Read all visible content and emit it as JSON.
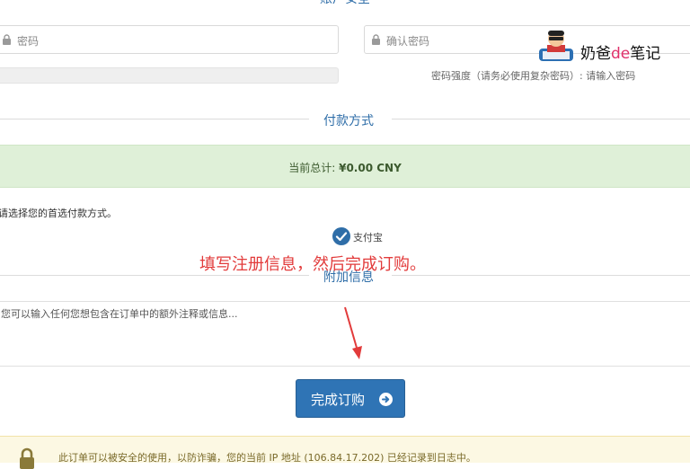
{
  "account_section": {
    "title": "账户安全"
  },
  "password": {
    "placeholder": "密码"
  },
  "confirm_password": {
    "placeholder": "确认密码"
  },
  "strength": {
    "text": "密码强度（请务必使用复杂密码）: 请输入密码"
  },
  "watermark": {
    "text_pre": "奶爸",
    "text_de": "de",
    "text_post": "笔记"
  },
  "payment_section": {
    "title": "付款方式"
  },
  "total": {
    "label": "当前总计:",
    "amount": "¥0.00 CNY"
  },
  "payment": {
    "choose_text": "请选择您的首选付款方式。",
    "option_label": "支付宝"
  },
  "annotation": {
    "text": "填写注册信息，然后完成订购。"
  },
  "notes_section": {
    "title": "附加信息"
  },
  "notes": {
    "placeholder": "您可以输入任何您想包含在订单中的额外注释或信息..."
  },
  "submit": {
    "label": "完成订购"
  },
  "security_notice": {
    "text": "此订单可以被安全的使用，以防诈骗，您的当前 IP 地址 (106.84.17.202) 已经记录到日志中。"
  },
  "colors": {
    "accent": "#2f74b5",
    "success_bg": "#dff0d8",
    "annotation": "#e23b3b",
    "warning_bg": "#fcf8e3"
  }
}
